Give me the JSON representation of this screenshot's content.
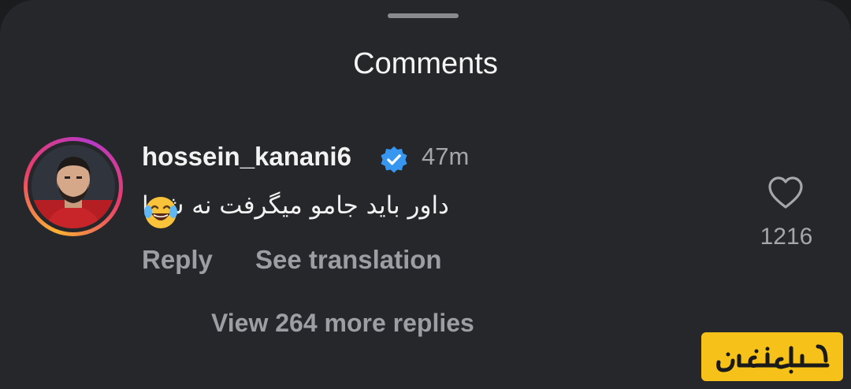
{
  "sheet": {
    "title": "Comments"
  },
  "comment": {
    "username": "hossein_kanani6",
    "verified": true,
    "time": "47m",
    "text": "داور باید جامو میگرفت نه شما",
    "emoji": "face-with-tears-of-joy",
    "reply_label": "Reply",
    "translate_label": "See translation",
    "like_count": "1216",
    "view_replies_label": "View 264 more replies"
  },
  "watermark": {
    "text": "ساعدنیوز"
  },
  "colors": {
    "background": "#26272b",
    "verified": "#3797f0",
    "watermark": "#f6c21a"
  }
}
